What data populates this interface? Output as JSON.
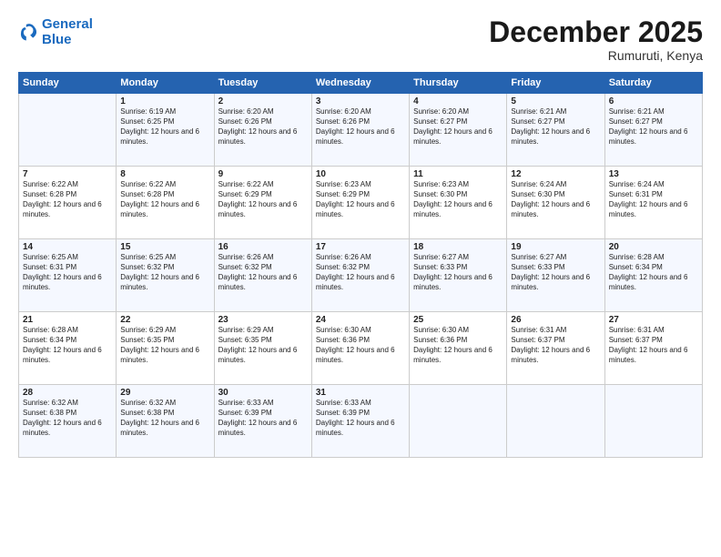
{
  "logo": {
    "line1": "General",
    "line2": "Blue"
  },
  "title": "December 2025",
  "location": "Rumuruti, Kenya",
  "headers": [
    "Sunday",
    "Monday",
    "Tuesday",
    "Wednesday",
    "Thursday",
    "Friday",
    "Saturday"
  ],
  "weeks": [
    [
      {
        "day": "",
        "sunrise": "",
        "sunset": "",
        "daylight": ""
      },
      {
        "day": "1",
        "sunrise": "6:19 AM",
        "sunset": "6:25 PM",
        "daylight": "12 hours and 6 minutes."
      },
      {
        "day": "2",
        "sunrise": "6:20 AM",
        "sunset": "6:26 PM",
        "daylight": "12 hours and 6 minutes."
      },
      {
        "day": "3",
        "sunrise": "6:20 AM",
        "sunset": "6:26 PM",
        "daylight": "12 hours and 6 minutes."
      },
      {
        "day": "4",
        "sunrise": "6:20 AM",
        "sunset": "6:27 PM",
        "daylight": "12 hours and 6 minutes."
      },
      {
        "day": "5",
        "sunrise": "6:21 AM",
        "sunset": "6:27 PM",
        "daylight": "12 hours and 6 minutes."
      },
      {
        "day": "6",
        "sunrise": "6:21 AM",
        "sunset": "6:27 PM",
        "daylight": "12 hours and 6 minutes."
      }
    ],
    [
      {
        "day": "7",
        "sunrise": "6:22 AM",
        "sunset": "6:28 PM",
        "daylight": "12 hours and 6 minutes."
      },
      {
        "day": "8",
        "sunrise": "6:22 AM",
        "sunset": "6:28 PM",
        "daylight": "12 hours and 6 minutes."
      },
      {
        "day": "9",
        "sunrise": "6:22 AM",
        "sunset": "6:29 PM",
        "daylight": "12 hours and 6 minutes."
      },
      {
        "day": "10",
        "sunrise": "6:23 AM",
        "sunset": "6:29 PM",
        "daylight": "12 hours and 6 minutes."
      },
      {
        "day": "11",
        "sunrise": "6:23 AM",
        "sunset": "6:30 PM",
        "daylight": "12 hours and 6 minutes."
      },
      {
        "day": "12",
        "sunrise": "6:24 AM",
        "sunset": "6:30 PM",
        "daylight": "12 hours and 6 minutes."
      },
      {
        "day": "13",
        "sunrise": "6:24 AM",
        "sunset": "6:31 PM",
        "daylight": "12 hours and 6 minutes."
      }
    ],
    [
      {
        "day": "14",
        "sunrise": "6:25 AM",
        "sunset": "6:31 PM",
        "daylight": "12 hours and 6 minutes."
      },
      {
        "day": "15",
        "sunrise": "6:25 AM",
        "sunset": "6:32 PM",
        "daylight": "12 hours and 6 minutes."
      },
      {
        "day": "16",
        "sunrise": "6:26 AM",
        "sunset": "6:32 PM",
        "daylight": "12 hours and 6 minutes."
      },
      {
        "day": "17",
        "sunrise": "6:26 AM",
        "sunset": "6:32 PM",
        "daylight": "12 hours and 6 minutes."
      },
      {
        "day": "18",
        "sunrise": "6:27 AM",
        "sunset": "6:33 PM",
        "daylight": "12 hours and 6 minutes."
      },
      {
        "day": "19",
        "sunrise": "6:27 AM",
        "sunset": "6:33 PM",
        "daylight": "12 hours and 6 minutes."
      },
      {
        "day": "20",
        "sunrise": "6:28 AM",
        "sunset": "6:34 PM",
        "daylight": "12 hours and 6 minutes."
      }
    ],
    [
      {
        "day": "21",
        "sunrise": "6:28 AM",
        "sunset": "6:34 PM",
        "daylight": "12 hours and 6 minutes."
      },
      {
        "day": "22",
        "sunrise": "6:29 AM",
        "sunset": "6:35 PM",
        "daylight": "12 hours and 6 minutes."
      },
      {
        "day": "23",
        "sunrise": "6:29 AM",
        "sunset": "6:35 PM",
        "daylight": "12 hours and 6 minutes."
      },
      {
        "day": "24",
        "sunrise": "6:30 AM",
        "sunset": "6:36 PM",
        "daylight": "12 hours and 6 minutes."
      },
      {
        "day": "25",
        "sunrise": "6:30 AM",
        "sunset": "6:36 PM",
        "daylight": "12 hours and 6 minutes."
      },
      {
        "day": "26",
        "sunrise": "6:31 AM",
        "sunset": "6:37 PM",
        "daylight": "12 hours and 6 minutes."
      },
      {
        "day": "27",
        "sunrise": "6:31 AM",
        "sunset": "6:37 PM",
        "daylight": "12 hours and 6 minutes."
      }
    ],
    [
      {
        "day": "28",
        "sunrise": "6:32 AM",
        "sunset": "6:38 PM",
        "daylight": "12 hours and 6 minutes."
      },
      {
        "day": "29",
        "sunrise": "6:32 AM",
        "sunset": "6:38 PM",
        "daylight": "12 hours and 6 minutes."
      },
      {
        "day": "30",
        "sunrise": "6:33 AM",
        "sunset": "6:39 PM",
        "daylight": "12 hours and 6 minutes."
      },
      {
        "day": "31",
        "sunrise": "6:33 AM",
        "sunset": "6:39 PM",
        "daylight": "12 hours and 6 minutes."
      },
      {
        "day": "",
        "sunrise": "",
        "sunset": "",
        "daylight": ""
      },
      {
        "day": "",
        "sunrise": "",
        "sunset": "",
        "daylight": ""
      },
      {
        "day": "",
        "sunrise": "",
        "sunset": "",
        "daylight": ""
      }
    ]
  ]
}
